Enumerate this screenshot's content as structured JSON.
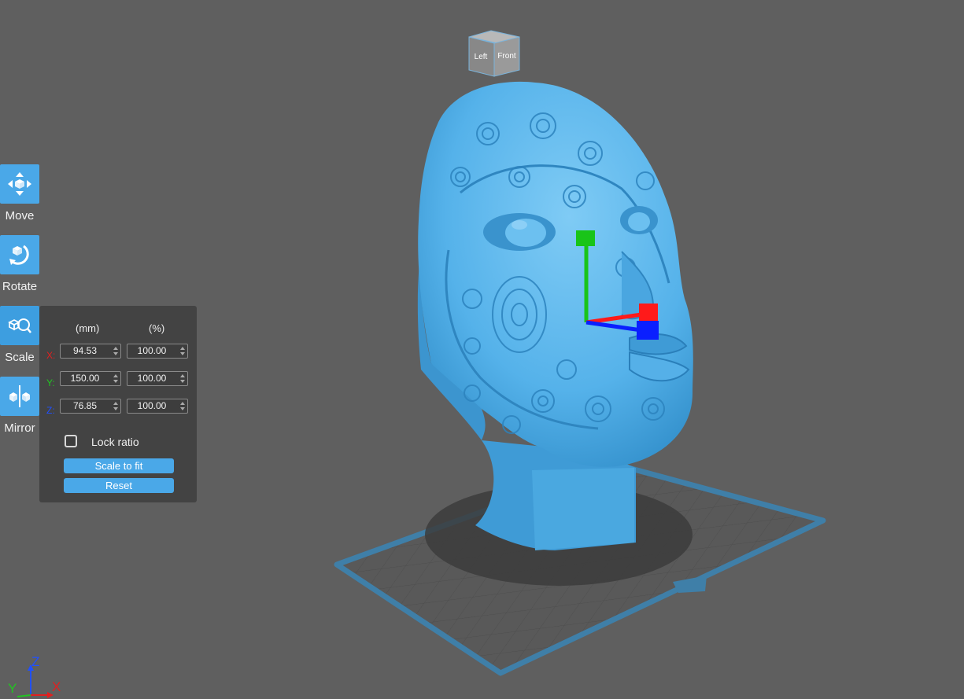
{
  "toolbar": {
    "items": [
      {
        "label": "Move"
      },
      {
        "label": "Rotate"
      },
      {
        "label": "Scale"
      },
      {
        "label": "Mirror"
      }
    ]
  },
  "scale_panel": {
    "col_mm": "(mm)",
    "col_pct": "(%)",
    "rows": [
      {
        "axis": "X:",
        "axis_color": "#e02020",
        "mm": "94.53",
        "pct": "100.00"
      },
      {
        "axis": "Y:",
        "axis_color": "#22c422",
        "mm": "150.00",
        "pct": "100.00"
      },
      {
        "axis": "Z:",
        "axis_color": "#2050ff",
        "mm": "76.85",
        "pct": "100.00"
      }
    ],
    "lock_ratio_label": "Lock ratio",
    "lock_ratio_checked": false,
    "scale_to_fit_label": "Scale to fit",
    "reset_label": "Reset"
  },
  "view_cube": {
    "left": "Left",
    "front": "Front"
  },
  "axis_triad": {
    "x": "X",
    "y": "Y",
    "z": "Z"
  },
  "colors": {
    "accent": "#4aa8e8",
    "model": "#57b4ec",
    "background": "#5f5f5f",
    "build_plate_border": "#3f7fa8",
    "gizmo_x": "#ff1a1a",
    "gizmo_y": "#19c419",
    "gizmo_z": "#0a1fff"
  }
}
